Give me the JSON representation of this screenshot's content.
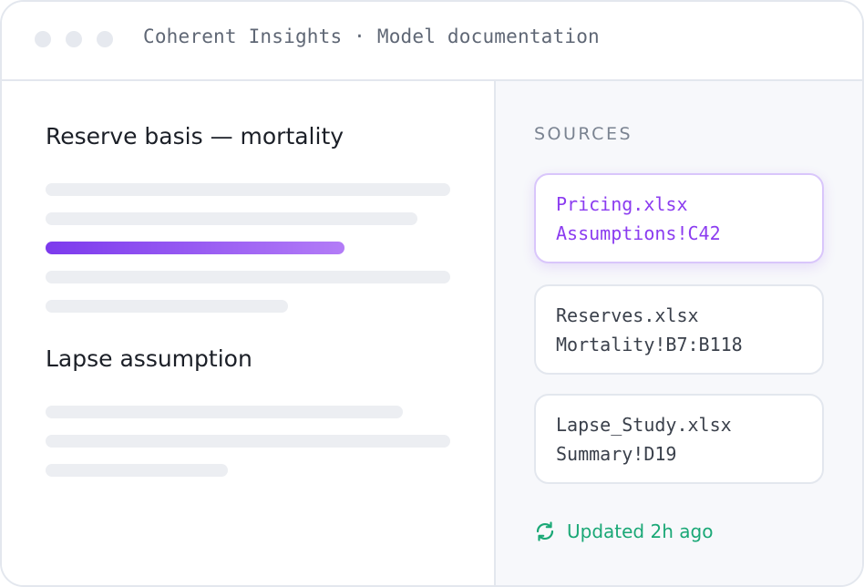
{
  "window": {
    "title": "Coherent Insights · Model documentation"
  },
  "document": {
    "sections": [
      {
        "heading": "Reserve basis — mortality"
      },
      {
        "heading": "Lapse assumption"
      }
    ]
  },
  "sources": {
    "label": "SOURCES",
    "items": [
      {
        "file": "Pricing.xlsx",
        "range": "Assumptions!C42",
        "active": true
      },
      {
        "file": "Reserves.xlsx",
        "range": "Mortality!B7:B118",
        "active": false
      },
      {
        "file": "Lapse_Study.xlsx",
        "range": "Summary!D19",
        "active": false
      }
    ],
    "status": {
      "text": "Updated 2h ago",
      "icon": "refresh-icon"
    }
  },
  "colors": {
    "accent": "#7c3aed",
    "success": "#1aa876",
    "placeholder": "#eceef2"
  }
}
